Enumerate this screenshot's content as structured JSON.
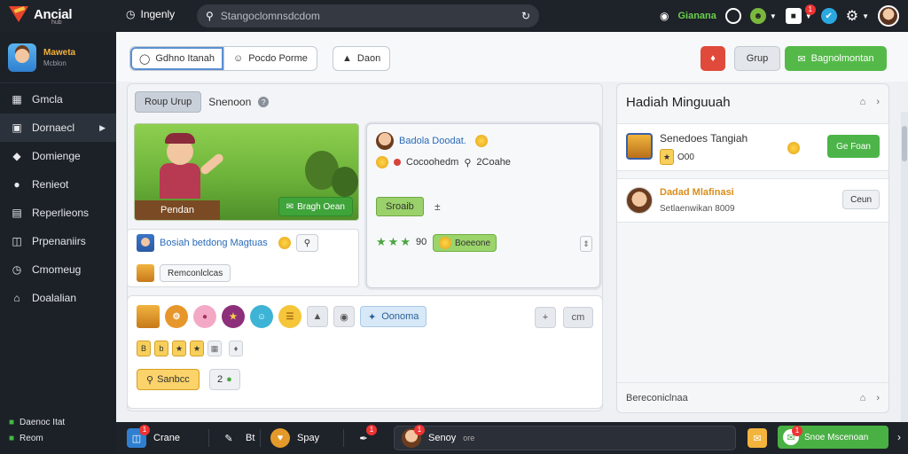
{
  "header": {
    "logo_text": "Ancial",
    "logo_sub": "hub",
    "nav_label": "Ingenly",
    "search_placeholder": "Stangoclomnsdcdom",
    "right_label": "Gianana",
    "notif_count": "1"
  },
  "sidebar": {
    "profile_name": "Maweta",
    "profile_sub": "Mcblon",
    "items": [
      {
        "label": "Gmcla",
        "icon": "grid-icon"
      },
      {
        "label": "Dornaecl",
        "icon": "tile-icon",
        "active": true
      },
      {
        "label": "Domienge",
        "icon": "tag-icon"
      },
      {
        "label": "Renieot",
        "icon": "users-icon"
      },
      {
        "label": "Reperlieons",
        "icon": "doc-icon"
      },
      {
        "label": "Prpenaniirs",
        "icon": "shield-icon"
      },
      {
        "label": "Cmomeug",
        "icon": "clock-icon"
      },
      {
        "label": "Doalalian",
        "icon": "home-icon"
      }
    ],
    "bottom_1": "Daenoc Itat",
    "bottom_2": "Reom"
  },
  "toolbar": {
    "tab_1": "Gdhno Itanah",
    "tab_2": "Pocdo Porme",
    "tab_3": "Daon",
    "group_label": "Grup",
    "green_label": "Bagnolmontan"
  },
  "left": {
    "tab_active": "Roup Urup",
    "tab_other": "Snenoon",
    "hero_label": "Pendan",
    "hero_button": "Bragh Oean",
    "mini_title": "Bosiah betdong Magtuas",
    "mini_pill": "Remconlclcas",
    "mid_title": "Badola Doodat.",
    "mid_sub": "Cocoohedm",
    "mid_sub_num": "2Coahe",
    "mid_button": "Sroaib",
    "stars_num": "90",
    "gpill_label": "Boeeone",
    "blue_pill": "Oonoma",
    "orange_btn": "Sanbcc",
    "count_pill": "2",
    "br_btn": "cm"
  },
  "right": {
    "title": "Hadiah Minguuah",
    "item1_title": "Senedoes Tangiah",
    "item1_sub": "O00",
    "item1_btn": "Ge Foan",
    "item2_title": "Dadad Mlafinasi",
    "item2_sub": "Setlaenwikan 8009",
    "item2_btn": "Ceun",
    "footer": "Bereconiclnaa"
  },
  "taskbar": {
    "item_1": "Crane",
    "item_2": "Bt",
    "item_3": "Spay",
    "chat_label": "Senoy",
    "chat_sub": "ore",
    "green_label": "Snoe Mscenoan",
    "badge": "1"
  }
}
